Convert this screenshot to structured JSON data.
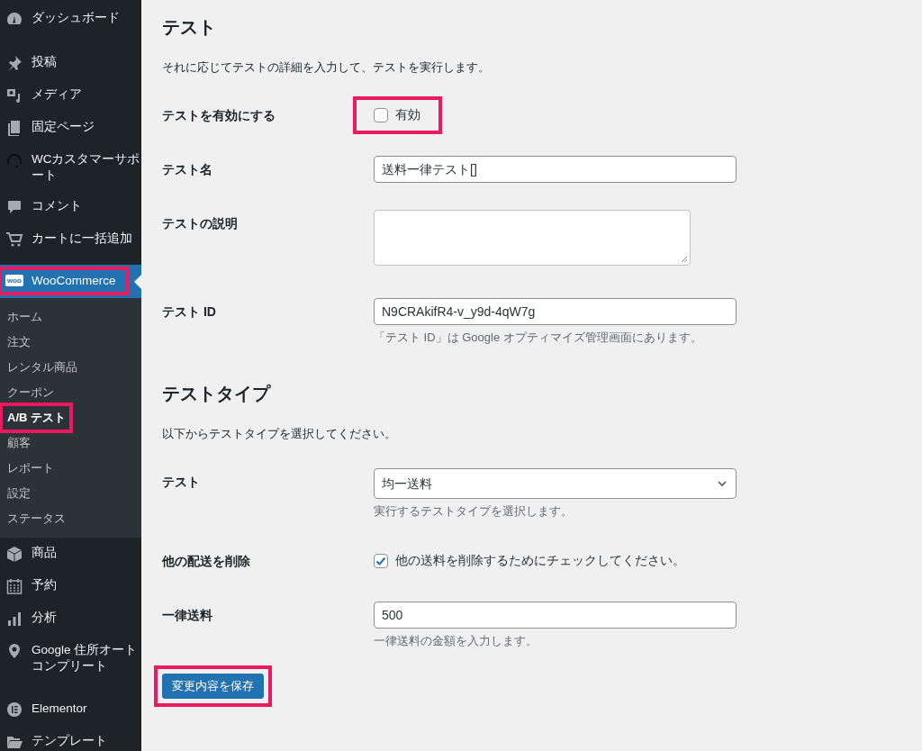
{
  "sidebar": {
    "items": [
      {
        "label": "ダッシュボード",
        "selected": false,
        "highlighted": false
      },
      {
        "label": "投稿",
        "selected": false,
        "highlighted": false
      },
      {
        "label": "メディア",
        "selected": false,
        "highlighted": false
      },
      {
        "label": "固定ページ",
        "selected": false,
        "highlighted": false
      },
      {
        "label": "WCカスタマーサポート",
        "selected": false,
        "highlighted": false
      },
      {
        "label": "コメント",
        "selected": false,
        "highlighted": false
      },
      {
        "label": "カートに一括追加",
        "selected": false,
        "highlighted": false
      },
      {
        "label": "WooCommerce",
        "logo_text": "woo",
        "selected": true,
        "highlighted": true,
        "children": [
          {
            "label": "ホーム",
            "selected": false,
            "highlighted": false
          },
          {
            "label": "注文",
            "selected": false,
            "highlighted": false
          },
          {
            "label": "レンタル商品",
            "selected": false,
            "highlighted": false
          },
          {
            "label": "クーポン",
            "selected": false,
            "highlighted": false
          },
          {
            "label": "A/B テスト",
            "selected": true,
            "highlighted": true
          },
          {
            "label": "顧客",
            "selected": false,
            "highlighted": false
          },
          {
            "label": "レポート",
            "selected": false,
            "highlighted": false
          },
          {
            "label": "設定",
            "selected": false,
            "highlighted": false
          },
          {
            "label": "ステータス",
            "selected": false,
            "highlighted": false
          }
        ]
      },
      {
        "label": "商品",
        "selected": false,
        "highlighted": false
      },
      {
        "label": "予約",
        "selected": false,
        "highlighted": false
      },
      {
        "label": "分析",
        "selected": false,
        "highlighted": false
      },
      {
        "label": "Google 住所オートコンプリート",
        "selected": false,
        "highlighted": false
      },
      {
        "label": "Elementor",
        "selected": false,
        "highlighted": false
      },
      {
        "label": "テンプレート",
        "selected": false,
        "highlighted": false
      }
    ]
  },
  "sections": [
    {
      "title": "テスト",
      "description": "それに応じてテストの詳細を入力して、テストを実行します。",
      "fields": [
        {
          "kind": "checkbox",
          "label": "テストを有効にする",
          "option": "有効",
          "checked": false,
          "highlighted": true
        },
        {
          "kind": "text",
          "label": "テスト名",
          "value": "送料一律テスト[]",
          "highlighted": false
        },
        {
          "kind": "textarea",
          "label": "テストの説明",
          "highlighted": false
        },
        {
          "kind": "text",
          "label": "テスト ID",
          "value": "N9CRAkifR4-v_y9d-4qW7g",
          "help": "「テスト ID」は Google オプティマイズ管理画面にあります。",
          "highlighted": false
        }
      ]
    },
    {
      "title": "テストタイプ",
      "description": "以下からテストタイプを選択してください。",
      "fields": [
        {
          "kind": "select",
          "label": "テスト",
          "value": "均一送料",
          "help": "実行するテストタイプを選択します。",
          "highlighted": false
        },
        {
          "kind": "checkbox",
          "label": "他の配送を削除",
          "option": "他の送料を削除するためにチェックしてください。",
          "checked": true,
          "highlighted": false
        },
        {
          "kind": "text",
          "label": "一律送料",
          "value": "500",
          "help": "一律送料の金額を入力します。",
          "highlighted": false
        }
      ]
    }
  ],
  "save_button": {
    "label": "変更内容を保存",
    "highlighted": true
  }
}
